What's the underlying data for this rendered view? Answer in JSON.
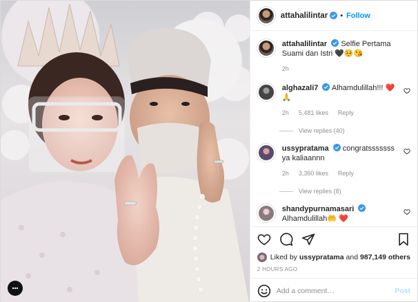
{
  "header": {
    "username": "attahalilintar",
    "separator": "•",
    "follow_label": "Follow"
  },
  "caption": {
    "username": "attahalilintar",
    "text": "Selfie Pertama Suami dan Istri 🖤🥺😘",
    "time": "2h"
  },
  "comments": [
    {
      "username": "alghazali7",
      "text": "Alhamdulillah!!! ❤️🙏",
      "time": "2h",
      "likes": "5,481 likes",
      "reply_label": "Reply",
      "view_replies": "View replies (40)"
    },
    {
      "username": "ussypratama",
      "text": "congratsssssss ya kaliaannn",
      "time": "2h",
      "likes": "3,360 likes",
      "reply_label": "Reply",
      "view_replies": "View replies (8)"
    },
    {
      "username": "shandypurnamasari",
      "text": "Alhamdulillah🤲 ❤️",
      "time": "",
      "likes": "",
      "reply_label": "",
      "view_replies": ""
    }
  ],
  "likes": {
    "prefix": "Liked by",
    "user": "ussypratama",
    "mid": "and",
    "count": "987,149 others"
  },
  "timestamp": "2 HOURS AGO",
  "add_comment": {
    "placeholder": "Add a comment…",
    "post_label": "Post"
  },
  "colors": {
    "link": "#0095f6",
    "muted": "#8e8e8e",
    "heart": "#ed4956"
  }
}
